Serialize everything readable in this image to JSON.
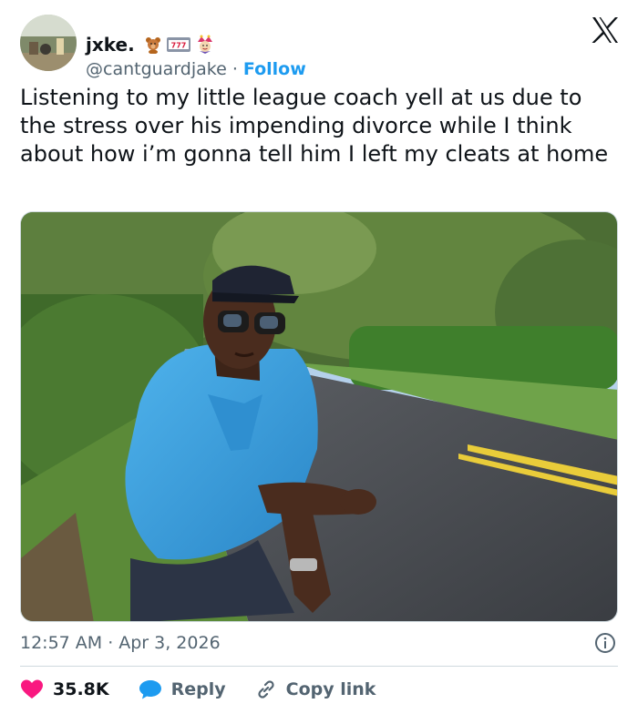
{
  "user": {
    "display_name": "jxke.",
    "handle": "@cantguardjake",
    "separator": "·",
    "follow_label": "Follow"
  },
  "tweet": {
    "text": "Listening to my little league coach yell at us due to the stress over his impending divorce while I think about how i’m gonna tell him I left my cleats at home",
    "time": "12:57 AM",
    "date": "Apr 3, 2026",
    "separator": "·"
  },
  "emoji_slot_text": "777",
  "actions": {
    "like_count": "35.8K",
    "reply_label": "Reply",
    "copy_link_label": "Copy link"
  },
  "colors": {
    "accent_blue": "#1d9bf0",
    "like_red": "#f91880",
    "muted_gray": "#536471",
    "text_dark": "#0f1419"
  },
  "icons": {
    "platform": "x-logo-icon",
    "info": "info-icon",
    "like": "heart-icon",
    "reply": "speech-bubble-icon",
    "copy": "link-icon"
  }
}
